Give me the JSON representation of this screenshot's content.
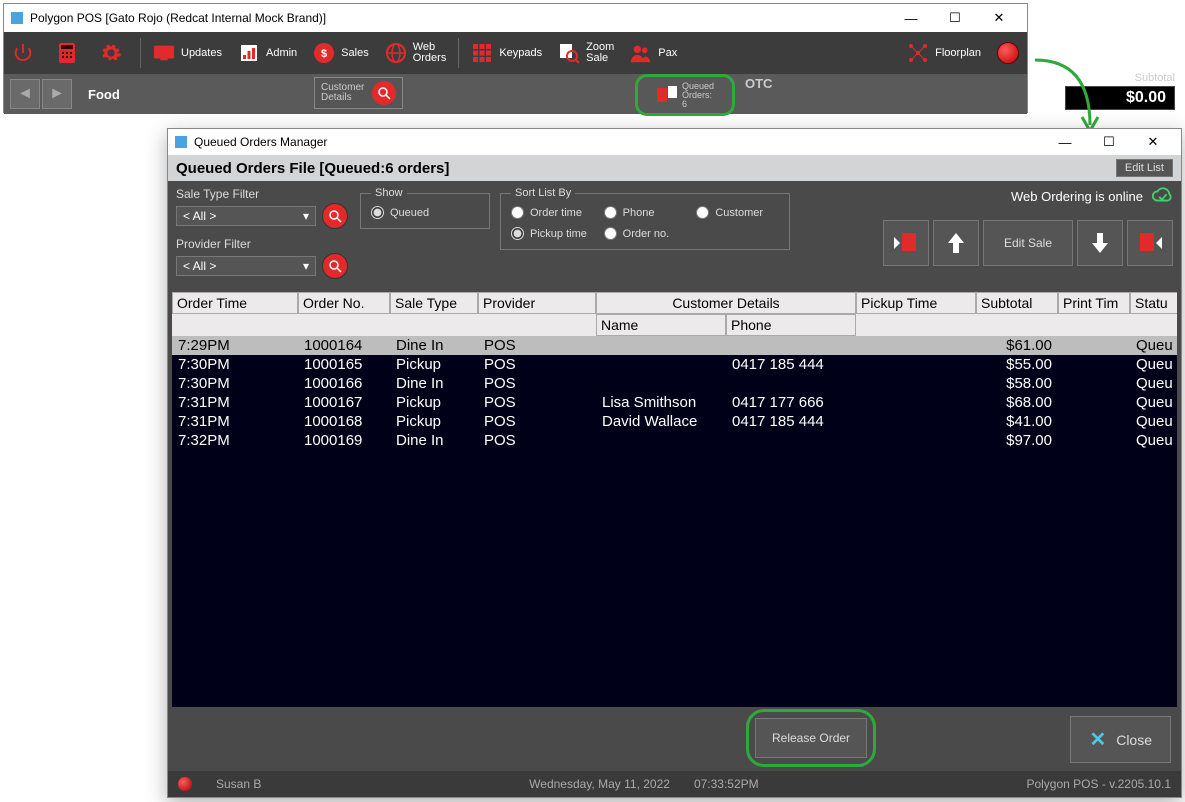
{
  "main": {
    "title": "Polygon POS  [Gato Rojo (Redcat Internal Mock Brand)]",
    "toolbar": {
      "updates": "Updates",
      "admin": "Admin",
      "sales": "Sales",
      "web_orders": "Web\nOrders",
      "keypads": "Keypads",
      "zoom_sale": "Zoom\nSale",
      "pax": "Pax",
      "floorplan": "Floorplan"
    },
    "food": "Food",
    "customer_details": "Customer\nDetails",
    "queued_orders_btn": "Queued\nOrders:\n6",
    "otc": "OTC",
    "subtotal_label": "Subtotal",
    "subtotal_value": "$0.00"
  },
  "dialog": {
    "title": "Queued Orders Manager",
    "qof_header": "Queued Orders File  [Queued:6 orders]",
    "edit_list": "Edit List",
    "sale_type_filter_label": "Sale Type Filter",
    "sale_type_filter_value": "< All >",
    "provider_filter_label": "Provider Filter",
    "provider_filter_value": "< All >",
    "show_legend": "Show",
    "show_queued": "Queued",
    "sort_legend": "Sort List By",
    "sort": {
      "order_time": "Order time",
      "phone": "Phone",
      "customer": "Customer",
      "pickup_time": "Pickup time",
      "order_no": "Order no."
    },
    "web_online": "Web Ordering is online",
    "edit_sale": "Edit Sale",
    "columns": {
      "order_time": "Order Time",
      "order_no": "Order No.",
      "sale_type": "Sale Type",
      "provider": "Provider",
      "customer_details": "Customer Details",
      "name": "Name",
      "phone": "Phone",
      "pickup_time": "Pickup Time",
      "subtotal": "Subtotal",
      "print_time": "Print Tim",
      "status": "Statu"
    },
    "rows": [
      {
        "order_time": "7:29PM",
        "order_no": "1000164",
        "sale_type": "Dine In",
        "provider": "POS",
        "name": "",
        "phone": "",
        "pickup": "",
        "subtotal": "$61.00",
        "print": "",
        "status": "Queu"
      },
      {
        "order_time": "7:30PM",
        "order_no": "1000165",
        "sale_type": "Pickup",
        "provider": "POS",
        "name": "",
        "phone": "0417 185 444",
        "pickup": "",
        "subtotal": "$55.00",
        "print": "",
        "status": "Queu"
      },
      {
        "order_time": "7:30PM",
        "order_no": "1000166",
        "sale_type": "Dine In",
        "provider": "POS",
        "name": "",
        "phone": "",
        "pickup": "",
        "subtotal": "$58.00",
        "print": "",
        "status": "Queu"
      },
      {
        "order_time": "7:31PM",
        "order_no": "1000167",
        "sale_type": "Pickup",
        "provider": "POS",
        "name": "Lisa Smithson",
        "phone": "0417 177 666",
        "pickup": "",
        "subtotal": "$68.00",
        "print": "",
        "status": "Queu"
      },
      {
        "order_time": "7:31PM",
        "order_no": "1000168",
        "sale_type": "Pickup",
        "provider": "POS",
        "name": "David Wallace",
        "phone": "0417 185 444",
        "pickup": "",
        "subtotal": "$41.00",
        "print": "",
        "status": "Queu"
      },
      {
        "order_time": "7:32PM",
        "order_no": "1000169",
        "sale_type": "Dine In",
        "provider": "POS",
        "name": "",
        "phone": "",
        "pickup": "",
        "subtotal": "$97.00",
        "print": "",
        "status": "Queu"
      }
    ],
    "release_order": "Release Order",
    "close": "Close",
    "status": {
      "user": "Susan B",
      "date": "Wednesday, May 11, 2022",
      "time": "07:33:52PM",
      "version": "Polygon POS - v.2205.10.1"
    }
  }
}
